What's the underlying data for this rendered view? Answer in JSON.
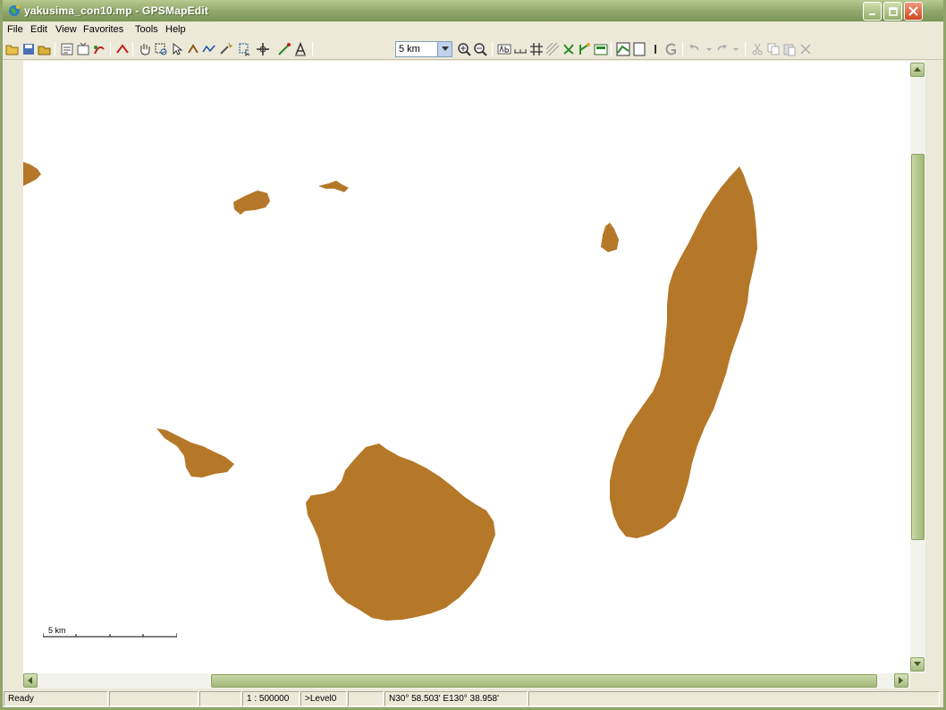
{
  "window": {
    "title": "yakusima_con10.mp - GPSMapEdit"
  },
  "menu": [
    {
      "label": "File"
    },
    {
      "label": "Edit"
    },
    {
      "label": "View"
    },
    {
      "label": "Favorites"
    },
    {
      "label": "Tools"
    },
    {
      "label": "Help"
    }
  ],
  "toolbar": {
    "scale_value": "5 km"
  },
  "map": {
    "land_color": "#b57828",
    "scalebar_label": "5 km"
  },
  "status": {
    "ready": "Ready",
    "scale": "1 : 500000",
    "level": ">Level0",
    "coords": "N30°  58.503'  E130°  38.958'"
  }
}
